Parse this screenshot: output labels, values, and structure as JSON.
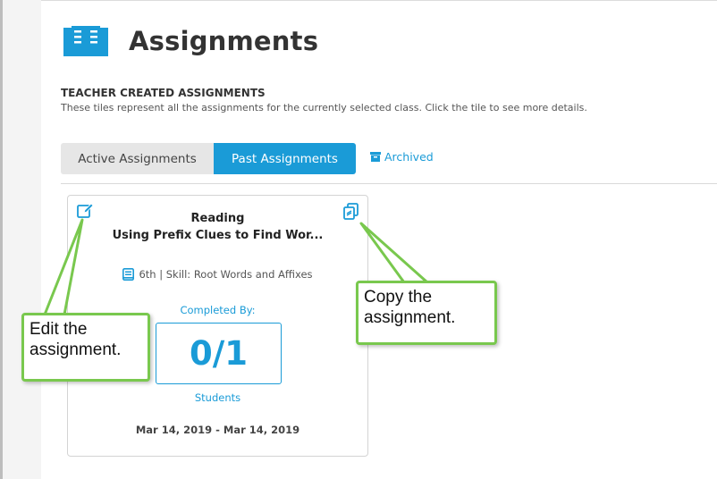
{
  "page": {
    "title": "Assignments",
    "title_icon": "open-book-icon"
  },
  "section": {
    "heading": "TEACHER CREATED ASSIGNMENTS",
    "description": "These tiles represent all the assignments for the currently selected class. Click the tile to see more details."
  },
  "tabs": {
    "active_label": "Active Assignments",
    "past_label": "Past Assignments",
    "archived_label": "Archived",
    "selected": "Past Assignments"
  },
  "card": {
    "subject": "Reading",
    "title": "Using Prefix Clues to Find Wor...",
    "meta": "6th | Skill: Root Words and Affixes",
    "completed_label": "Completed By:",
    "completed_count": "0/1",
    "students_label": "Students",
    "date_range": "Mar 14, 2019 - Mar 14, 2019",
    "edit_icon": "edit-icon",
    "copy_icon": "copy-icon"
  },
  "callouts": {
    "edit_line1": "Edit the",
    "edit_line2": "assignment.",
    "copy_line1": "Copy the",
    "copy_line2": "assignment."
  },
  "colors": {
    "accent": "#1a9bd7",
    "callout_border": "#79c84e",
    "tab_inactive_bg": "#e6e6e6"
  }
}
